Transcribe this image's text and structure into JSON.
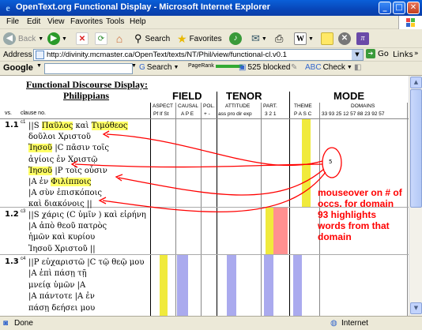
{
  "window": {
    "title": "OpenText.org Functional Display - Microsoft Internet Explorer",
    "minimize_glyph": "_",
    "maximize_glyph": "□",
    "close_glyph": "✕"
  },
  "menu": {
    "items": [
      "File",
      "Edit",
      "View",
      "Favorites",
      "Tools",
      "Help"
    ]
  },
  "toolbar": {
    "back_label": "Back",
    "search_label": "Search",
    "favorites_label": "Favorites"
  },
  "address": {
    "label": "Address",
    "url": "http://divinity.mcmaster.ca/OpenText/texts/NT/Phil/view/functional-cl.v0.1",
    "go_label": "Go",
    "links_label": "Links"
  },
  "google": {
    "label": "Google",
    "search_label": "Search",
    "pagerank_label": "PageRank",
    "blocked_label": "525 blocked",
    "check_label": "Check"
  },
  "page": {
    "title_line1": "Functional Discourse Display:",
    "title_line2": "Philippians",
    "vs_label": "vs.",
    "clause_label": "clause no.",
    "categories": {
      "field": "FIELD",
      "tenor": "TENOR",
      "mode": "MODE"
    },
    "subheads": {
      "aspect": "ASPECT",
      "aspect_cols": "Pf  If  St",
      "causal": "CAUSAL",
      "causal_cols": "A  P  E",
      "pol": "POL.",
      "pol_cols": "+  -",
      "attitude": "ATTITUDE",
      "attitude_cols": "ass pro dir exp",
      "part": "PART.",
      "part_cols": "3  2  1",
      "theme": "THEME",
      "theme_cols": "P  A  S  C",
      "domains": "DOMAINS",
      "domain_cols": "33 93 25 12 57 88 23 92 57"
    },
    "verses": [
      {
        "num": "1.1",
        "clause": "c1",
        "lines": [
          {
            "segments": [
              {
                "t": "||S ",
                "h": false
              },
              {
                "t": "Παῦλος",
                "h": true
              },
              {
                "t": " καὶ ",
                "h": false
              },
              {
                "t": "Τιμόθεος",
                "h": true
              }
            ]
          },
          {
            "segments": [
              {
                "t": "δοῦλοι Χριστοῦ",
                "h": false
              }
            ]
          },
          {
            "segments": [
              {
                "t": "Ἰησοῦ",
                "h": true
              },
              {
                "t": " |C πᾶσιν τοῖς",
                "h": false
              }
            ]
          },
          {
            "segments": [
              {
                "t": "ἁγίοις ἐν Χριστῷ",
                "h": false
              }
            ]
          },
          {
            "segments": [
              {
                "t": "Ἰησοῦ",
                "h": true
              },
              {
                "t": " |P τοῖς οὖσιν",
                "h": false
              }
            ]
          },
          {
            "segments": [
              {
                "t": "|A ἐν ",
                "h": false
              },
              {
                "t": "Φιλίπποις",
                "h": true
              }
            ]
          },
          {
            "segments": [
              {
                "t": "|A σὺν ἐπισκόποις",
                "h": false
              }
            ]
          },
          {
            "segments": [
              {
                "t": "καὶ διακόνοις ||",
                "h": false
              }
            ]
          }
        ]
      },
      {
        "num": "1.2",
        "clause": "c3",
        "lines": [
          {
            "segments": [
              {
                "t": "||S χάρις (C ὑμῖν ) καὶ εἰρήνη",
                "h": false
              }
            ]
          },
          {
            "segments": [
              {
                "t": "|A ἀπὸ θεοῦ πατρὸς",
                "h": false
              }
            ]
          },
          {
            "segments": [
              {
                "t": "ἡμῶν καὶ κυρίου",
                "h": false
              }
            ]
          },
          {
            "segments": [
              {
                "t": "Ἰησοῦ Χριστοῦ ||",
                "h": false
              }
            ]
          }
        ]
      },
      {
        "num": "1.3",
        "clause": "c4",
        "lines": [
          {
            "segments": [
              {
                "t": "||P εὐχαριστῶ |C τῷ θεῷ μου",
                "h": false
              }
            ]
          },
          {
            "segments": [
              {
                "t": "|A ἐπὶ πάσῃ τῇ",
                "h": false
              }
            ]
          },
          {
            "segments": [
              {
                "t": "μνείᾳ ὑμῶν |A",
                "h": false
              }
            ]
          },
          {
            "segments": [
              {
                "t": "|A πάντοτε |A ἐν",
                "h": false
              }
            ]
          },
          {
            "segments": [
              {
                "t": "πάσῃ δεήσει μου",
                "h": false
              }
            ]
          }
        ]
      }
    ],
    "bubble_value": "5",
    "annotation": "mouseover on # of occs. for domain 93 highlights words from that domain"
  },
  "status": {
    "done_label": "Done",
    "zone_label": "Internet"
  },
  "colors": {
    "highlight": "#ffff66",
    "bar_yellow": "#f0ea3c",
    "bar_lavender": "#aaaaee",
    "bar_pink": "#ff9090",
    "annotation_red": "#ff0000"
  }
}
